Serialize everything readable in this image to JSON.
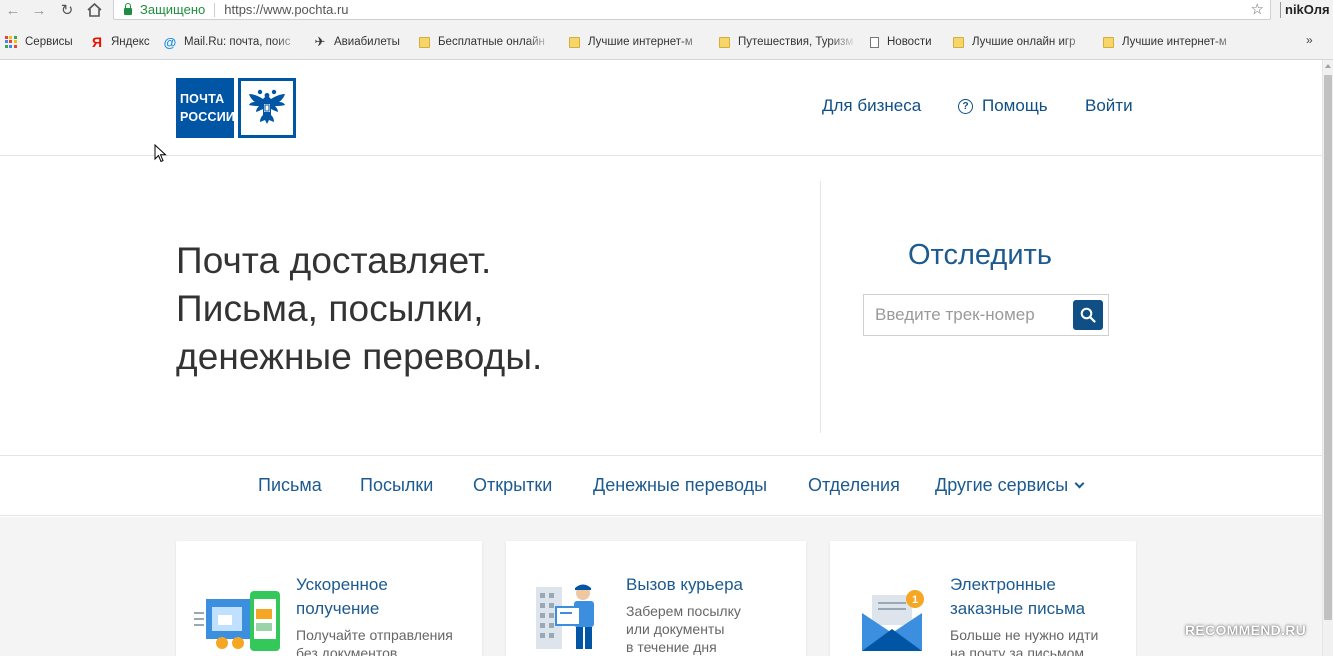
{
  "browser": {
    "secure_label": "Защищено",
    "url": "https://www.pochta.ru",
    "user_name": "nikОля",
    "bookmarks": [
      {
        "label": "Сервисы",
        "icon": "apps-icon"
      },
      {
        "label": "Яндекс",
        "icon": "yandex-icon"
      },
      {
        "label": "Mail.Ru: почта, поис",
        "icon": "mailru-icon"
      },
      {
        "label": "Авиабилеты",
        "icon": "plane-icon"
      },
      {
        "label": "Бесплатные онлайн",
        "icon": "folder-icon"
      },
      {
        "label": "Лучшие интернет-м",
        "icon": "folder-icon"
      },
      {
        "label": "Путешествия, Туризм",
        "icon": "folder-icon"
      },
      {
        "label": "Новости",
        "icon": "document-icon"
      },
      {
        "label": "Лучшие онлайн игр",
        "icon": "folder-icon"
      },
      {
        "label": "Лучшие интернет-м",
        "icon": "folder-icon"
      }
    ],
    "more_label": "»"
  },
  "header": {
    "logo_line1": "ПОЧТА",
    "logo_line2": "РОССИИ",
    "links": {
      "business": "Для бизнеса",
      "help": "Помощь",
      "login": "Войти"
    },
    "help_icon_glyph": "?"
  },
  "hero": {
    "lines": [
      "Почта доставляет.",
      "Письма, посылки,",
      "денежные переводы."
    ],
    "track_title": "Отследить",
    "track_placeholder": "Введите трек-номер"
  },
  "menu": {
    "items": [
      "Письма",
      "Посылки",
      "Открытки",
      "Денежные переводы",
      "Отделения",
      "Другие сервисы"
    ]
  },
  "cards": [
    {
      "title_line1": "Ускоренное",
      "title_line2": "получение",
      "desc_line1": "Получайте отправления",
      "desc_line2": "без документов"
    },
    {
      "title_line1": "Вызов курьера",
      "title_line2": "",
      "desc_line1": "Заберем посылку",
      "desc_line2": "или документы",
      "desc_line3": "в течение дня"
    },
    {
      "title_line1": "Электронные",
      "title_line2": "заказные письма",
      "desc_line1": "Больше не нужно идти",
      "desc_line2": "на почту за письмом"
    }
  ],
  "badge_count": "1",
  "watermark": "RECOMMEND.RU",
  "colors": {
    "brand_blue": "#0055a5",
    "link_blue": "#1c5a8f",
    "secure_green": "#1e8e3e",
    "badge_orange": "#f5a623"
  }
}
